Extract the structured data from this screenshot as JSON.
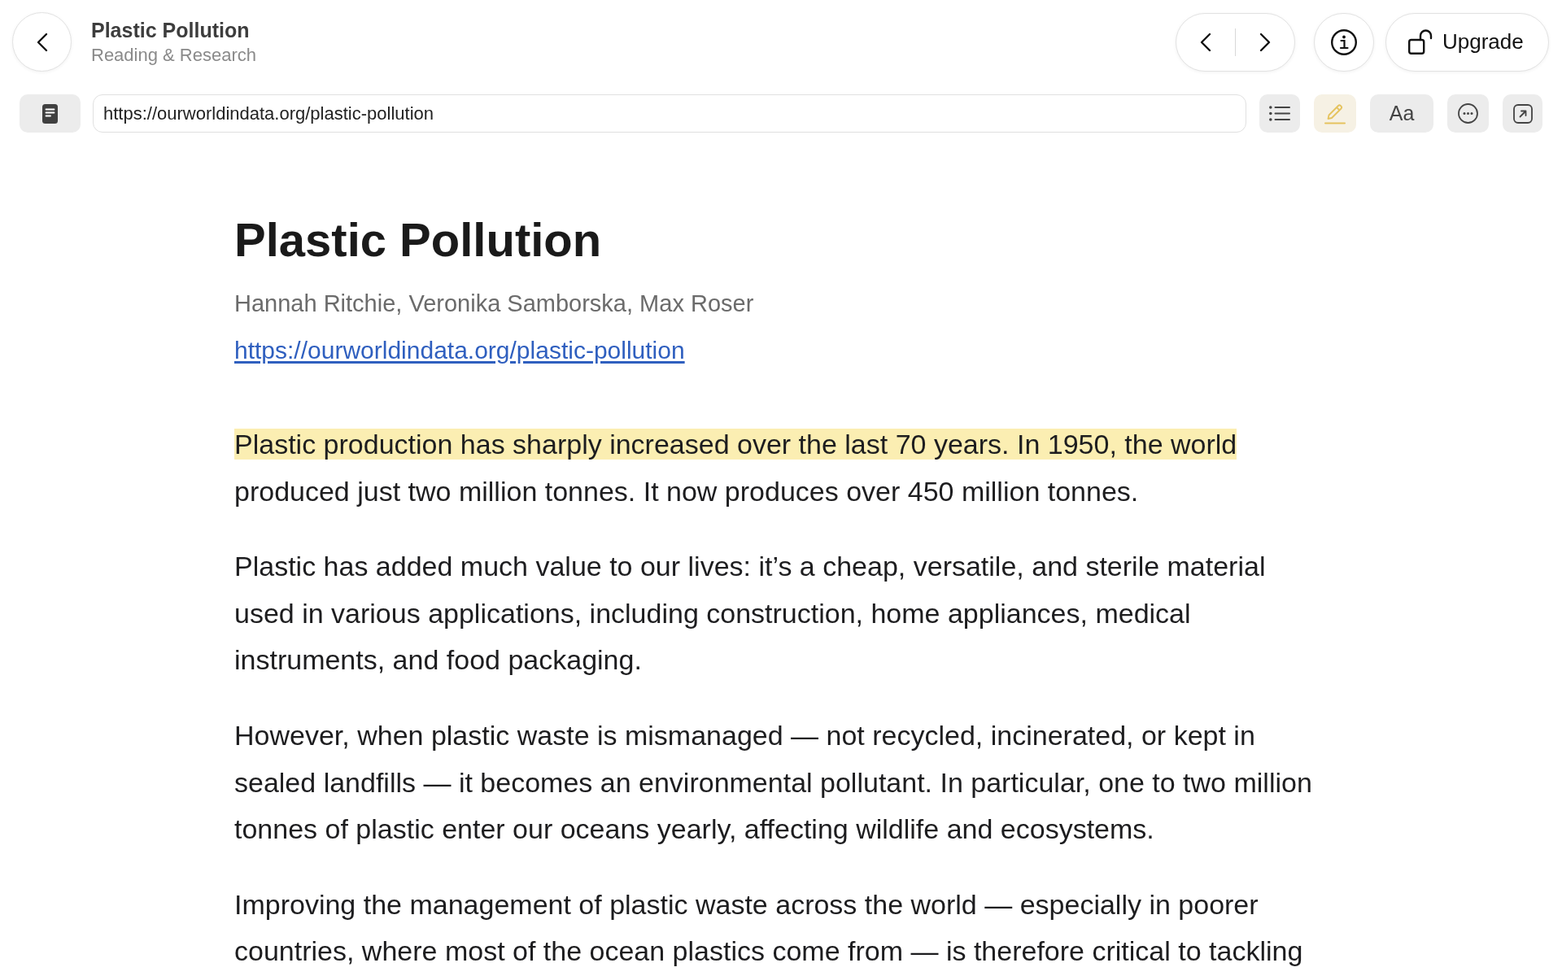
{
  "header": {
    "title": "Plastic Pollution",
    "subtitle": "Reading & Research",
    "upgrade_button": {
      "label": "Upgrade"
    }
  },
  "toolbar": {
    "url": "https://ourworldindata.org/plastic-pollution",
    "tools": [
      {
        "kind": "contents",
        "active": false
      },
      {
        "kind": "highlight",
        "active": true
      },
      {
        "kind": "font",
        "label": "Aa",
        "active": false
      },
      {
        "kind": "more",
        "active": false
      },
      {
        "kind": "open",
        "active": false
      }
    ]
  },
  "article": {
    "title": "Plastic Pollution",
    "authors": "Hannah Ritchie, Veronika Samborska, Max Roser",
    "link": "https://ourworldindata.org/plastic-pollution",
    "paragraphs": [
      {
        "segments": [
          {
            "text": "Plastic production has sharply increased over the last 70 years. In 1950, the world",
            "highlighted": true
          },
          {
            "text": "produced just two million tonnes. It now produces over 450 million tonnes.",
            "highlighted": false
          }
        ]
      },
      {
        "segments": [
          {
            "text": "Plastic has added much value to our lives: it’s a cheap, versatile, and sterile material used in various applications, including construction, home appliances, medical instruments, and food packaging.",
            "highlighted": false
          }
        ]
      },
      {
        "segments": [
          {
            "text": "However, when plastic waste is mismanaged — not recycled, incinerated, or kept in sealed landfills — it becomes an environmental pollutant. In particular, one to two million tonnes of plastic enter our oceans yearly, affecting wildlife and ecosystems.",
            "highlighted": false
          }
        ]
      },
      {
        "segments": [
          {
            "text": "Improving the management of plastic waste across the world — especially in poorer countries, where most of the ocean plastics come from — is therefore critical to tackling",
            "highlighted": false
          }
        ]
      }
    ]
  }
}
